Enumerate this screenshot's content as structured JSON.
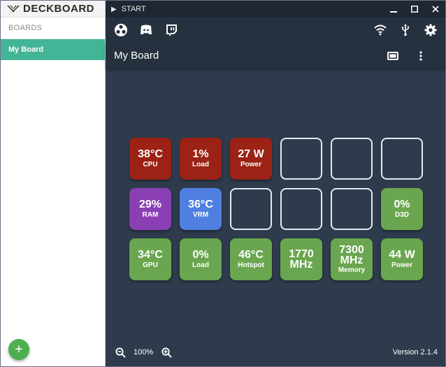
{
  "app": {
    "brand": "DECKBOARD"
  },
  "sidebar": {
    "header": "BOARDS",
    "items": [
      {
        "label": "My Board"
      }
    ],
    "add_label": "+"
  },
  "titlebar": {
    "start_arrow": "▶",
    "start_label": "START",
    "minimize": "—",
    "maximize": "☐",
    "close": "✕"
  },
  "toolbar": {
    "left_icons": [
      "obs-icon",
      "discord-icon",
      "twitch-icon"
    ],
    "right_icons": [
      "wifi-icon",
      "usb-icon",
      "settings-icon"
    ]
  },
  "board": {
    "title": "My Board",
    "tiles": [
      {
        "value": "38°C",
        "label": "CPU",
        "color": "#9b2214"
      },
      {
        "value": "1%",
        "label": "Load",
        "color": "#9b2214"
      },
      {
        "value": "27 W",
        "label": "Power",
        "color": "#9b2214"
      },
      {
        "value": "",
        "label": "",
        "color": ""
      },
      {
        "value": "",
        "label": "",
        "color": ""
      },
      {
        "value": "",
        "label": "",
        "color": ""
      },
      {
        "value": "29%",
        "label": "RAM",
        "color": "#8a3fb5"
      },
      {
        "value": "36°C",
        "label": "VRM",
        "color": "#4f7fe0"
      },
      {
        "value": "",
        "label": "",
        "color": ""
      },
      {
        "value": "",
        "label": "",
        "color": ""
      },
      {
        "value": "",
        "label": "",
        "color": ""
      },
      {
        "value": "0%",
        "label": "D3D",
        "color": "#6aa64f"
      },
      {
        "value": "34°C",
        "label": "GPU",
        "color": "#6aa64f"
      },
      {
        "value": "0%",
        "label": "Load",
        "color": "#6aa64f"
      },
      {
        "value": "46°C",
        "label": "Hotspot",
        "color": "#6aa64f"
      },
      {
        "value": "1770 MHz",
        "label": "",
        "color": "#6aa64f"
      },
      {
        "value": "7300 MHz",
        "label": "Memory",
        "color": "#6aa64f"
      },
      {
        "value": "44 W",
        "label": "Power",
        "color": "#6aa64f"
      }
    ]
  },
  "footer": {
    "zoom": "100%",
    "version": "Version 2.1.4"
  }
}
